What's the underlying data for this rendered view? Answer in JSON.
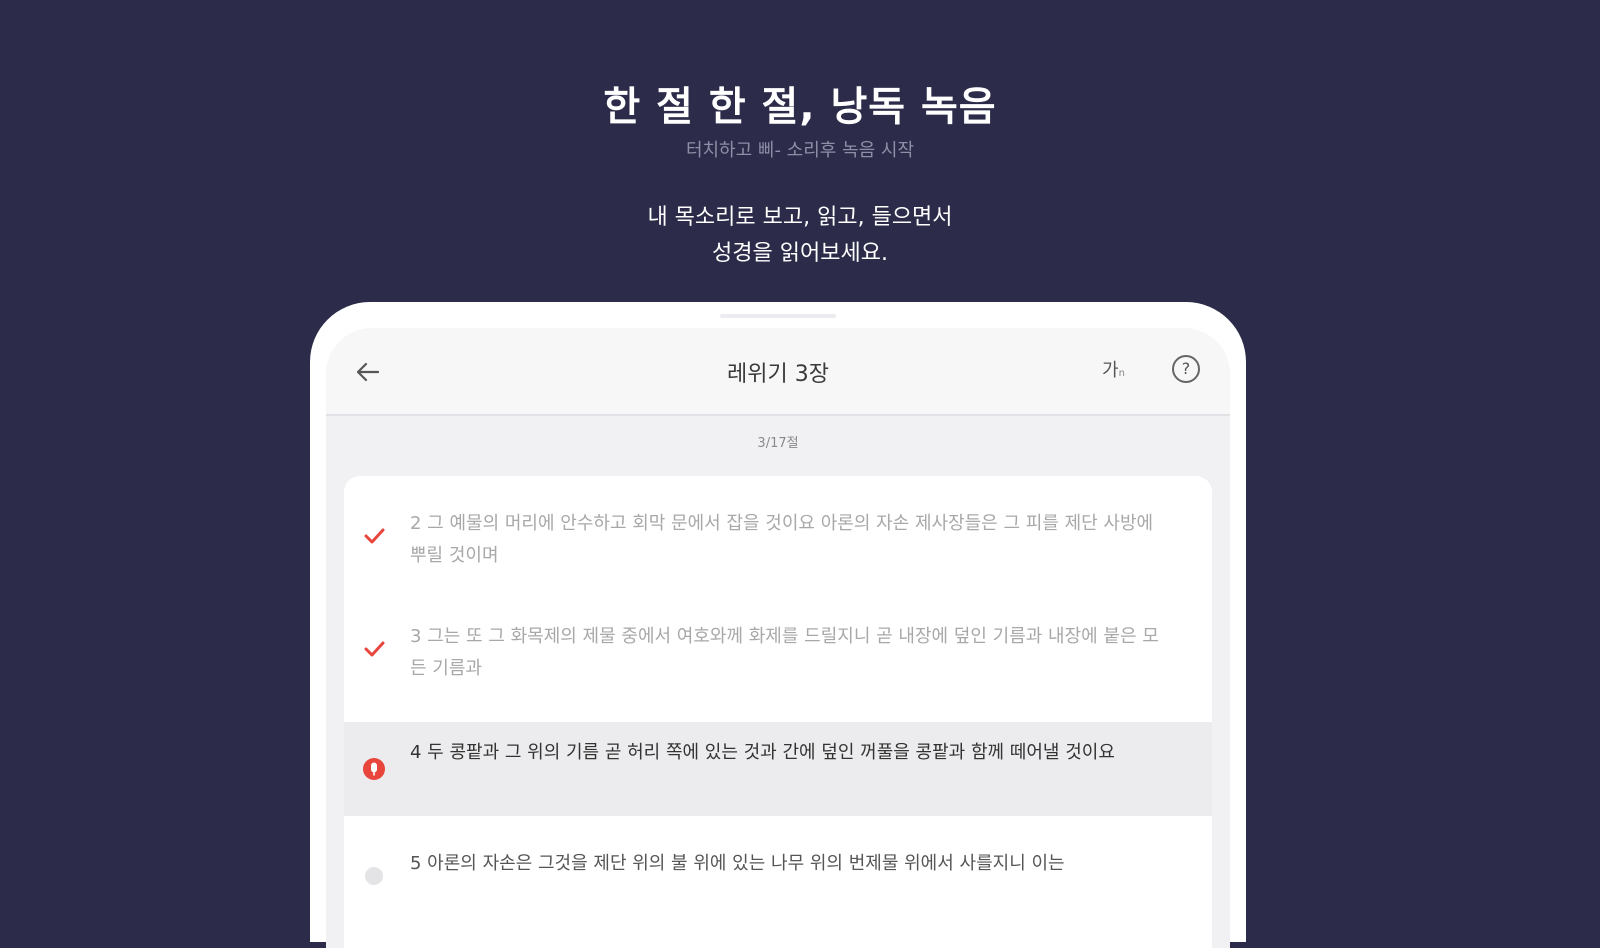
{
  "hero": {
    "title": "한 절 한 절, 낭독 녹음",
    "subtitle": "터치하고 삐- 소리후 녹음 시작",
    "desc_line1": "내 목소리로 보고, 읽고, 들으면서",
    "desc_line2": "성경을 읽어보세요."
  },
  "header": {
    "title": "레위기 3장",
    "font_label": "가",
    "font_sup": "n",
    "help_label": "?"
  },
  "progress": "3/17절",
  "colors": {
    "background": "#2c2c4a",
    "accent": "#e8453c"
  },
  "verses": [
    {
      "text": "2 그 예물의 머리에 안수하고 회막 문에서 잡을 것이요 아론의 자손 제사장들은 그 피를 제단 사방에 뿌릴 것이며",
      "status": "done",
      "icon": "checkmark-icon"
    },
    {
      "text": "3 그는 또 그 화목제의 제물 중에서 여호와께 화제를 드릴지니 곧 내장에 덮인 기름과 내장에 붙은 모든 기름과",
      "status": "done",
      "icon": "checkmark-icon"
    },
    {
      "text": "4 두 콩팥과 그 위의 기름 곧 허리 쪽에 있는 것과 간에 덮인 꺼풀을 콩팥과 함께 떼어낼 것이요",
      "status": "recording",
      "icon": "microphone-icon"
    },
    {
      "text": "5 아론의 자손은 그것을 제단 위의 불 위에 있는 나무 위의 번제물 위에서 사를지니 이는",
      "status": "pending",
      "icon": "pending-dot-icon"
    }
  ]
}
